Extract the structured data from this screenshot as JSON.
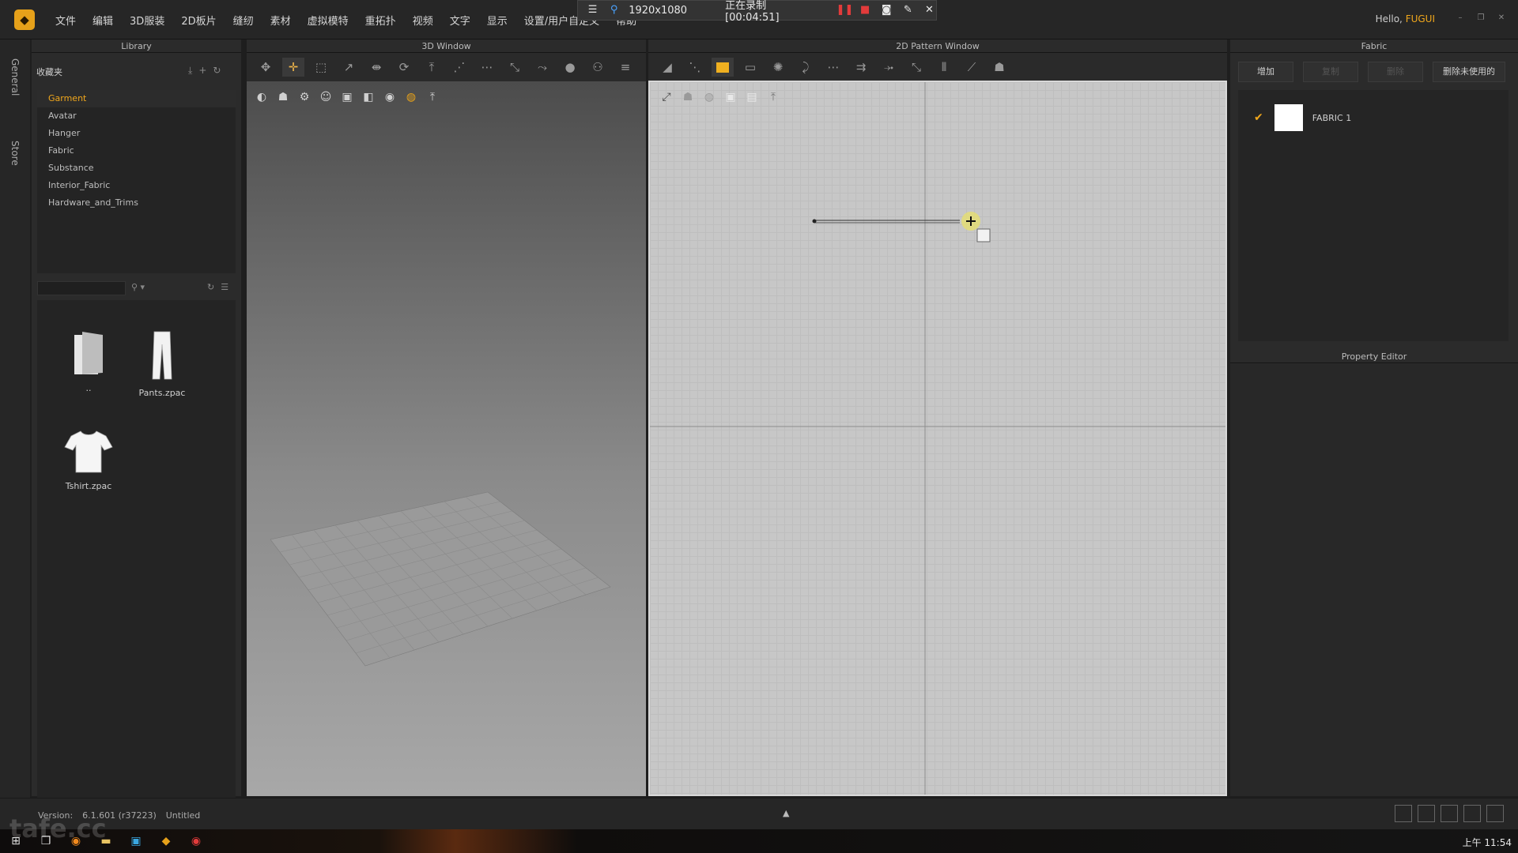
{
  "menu": {
    "items": [
      "文件",
      "编辑",
      "3D服装",
      "2D板片",
      "缝纫",
      "素材",
      "虚拟模特",
      "重拓扑",
      "视频",
      "文字",
      "显示",
      "设置/用户自定义",
      "帮助"
    ]
  },
  "recorder": {
    "resolution": "1920x1080",
    "status": "正在录制 [00:04:51]"
  },
  "user": {
    "greeting": "Hello, ",
    "name": "FUGUI"
  },
  "side_tabs": [
    "General",
    "Store"
  ],
  "library": {
    "title": "Library",
    "favorites_label": "收藏夹",
    "tree": [
      "Garment",
      "Avatar",
      "Hanger",
      "Fabric",
      "Substance",
      "Interior_Fabric",
      "Hardware_and_Trims"
    ],
    "active_item": "Garment",
    "files": [
      {
        "name": "..",
        "icon": "folder-up-icon"
      },
      {
        "name": "Pants.zpac",
        "icon": "pants-icon"
      },
      {
        "name": "Tshirt.zpac",
        "icon": "tshirt-icon"
      }
    ]
  },
  "window3d": {
    "title": "3D Window"
  },
  "window2d": {
    "title": "2D Pattern Window"
  },
  "fabric_panel": {
    "title": "Fabric",
    "buttons": [
      "增加",
      "复制",
      "删除",
      "删除未使用的"
    ],
    "fabrics": [
      {
        "name": "FABRIC 1",
        "color": "#ffffff",
        "checked": true
      }
    ]
  },
  "property_editor": {
    "title": "Property Editor"
  },
  "status": {
    "version_label": "Version:",
    "version": "6.1.601 (r37223)",
    "file": "Untitled"
  },
  "taskbar": {
    "clock": "上午 11:54"
  },
  "watermark": "tafe.cc",
  "colors": {
    "accent": "#f0a71c",
    "rec_red": "#e23b3b",
    "canvas": "#c7c7c7"
  }
}
